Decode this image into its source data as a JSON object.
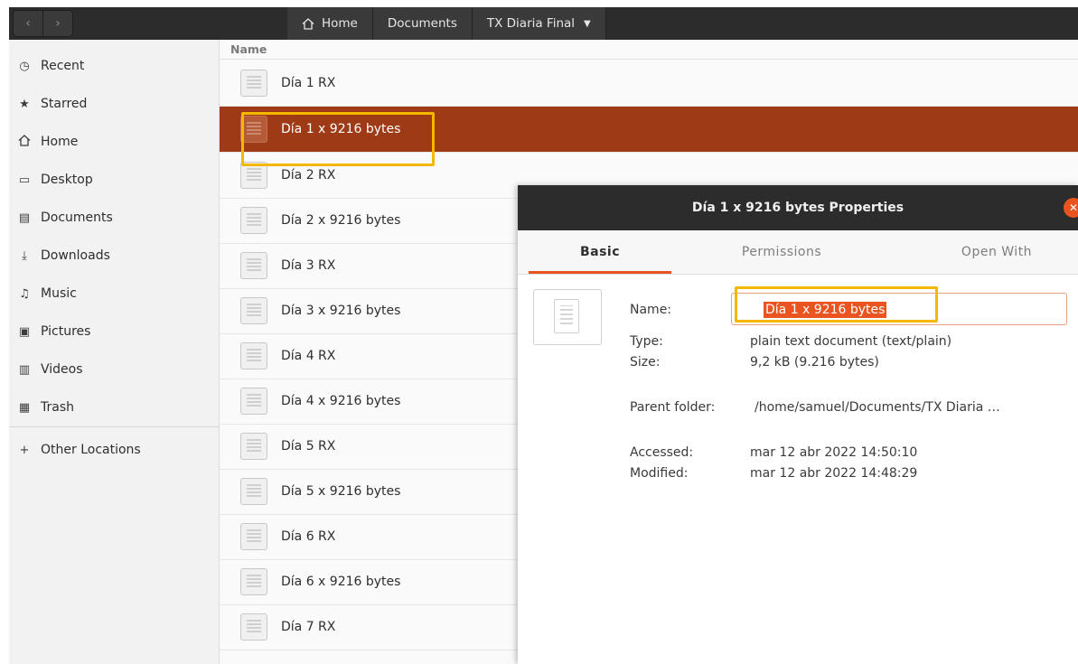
{
  "header": {
    "back_icon": "chevron-left-icon",
    "forward_icon": "chevron-right-icon",
    "breadcrumbs": [
      "Home",
      "Documents",
      "TX Diaria Final"
    ],
    "breadcrumb_dropdown_icon": "caret-down-icon"
  },
  "sidebar": {
    "items": [
      {
        "label": "Recent",
        "icon": "clock-icon"
      },
      {
        "label": "Starred",
        "icon": "star-icon"
      },
      {
        "label": "Home",
        "icon": "home-icon"
      },
      {
        "label": "Desktop",
        "icon": "desktop-icon"
      },
      {
        "label": "Documents",
        "icon": "document-icon"
      },
      {
        "label": "Downloads",
        "icon": "download-icon"
      },
      {
        "label": "Music",
        "icon": "music-icon"
      },
      {
        "label": "Pictures",
        "icon": "picture-icon"
      },
      {
        "label": "Videos",
        "icon": "video-icon"
      },
      {
        "label": "Trash",
        "icon": "trash-icon"
      },
      {
        "label": "Other Locations",
        "icon": "plus-icon"
      }
    ]
  },
  "filelist": {
    "column_name": "Name",
    "files": [
      "Día 1 RX",
      "Día 1 x 9216 bytes",
      "Día 2 RX",
      "Día 2 x 9216 bytes",
      "Día 3 RX",
      "Día 3 x 9216 bytes",
      "Día 4 RX",
      "Día 4 x 9216 bytes",
      "Día 5 RX",
      "Día 5 x 9216 bytes",
      "Día 6 RX",
      "Día 6 x 9216 bytes",
      "Día 7 RX"
    ],
    "selected_file": "Día 1 x 9216 bytes"
  },
  "dialog": {
    "title": "Día 1 x 9216 bytes Properties",
    "close_icon": "close-icon",
    "tabs": [
      "Basic",
      "Permissions",
      "Open With"
    ],
    "active_tab": "Basic",
    "name_label": "Name:",
    "name_value": "Día 1 x 9216 bytes",
    "type_label": "Type:",
    "type_value": "plain text document (text/plain)",
    "size_label": "Size:",
    "size_value": "9,2 kB (9.216 bytes)",
    "parent_label": "Parent folder:",
    "parent_value": "/home/samuel/Documents/TX Diaria …",
    "accessed_label": "Accessed:",
    "accessed_value": "mar 12 abr 2022 14:50:10",
    "modified_label": "Modified:",
    "modified_value": "mar 12 abr 2022 14:48:29"
  },
  "colors": {
    "selection": "#9f3a17",
    "accent": "#e95420",
    "annotation": "#f5b800",
    "headerbar": "#2c2c2c"
  }
}
